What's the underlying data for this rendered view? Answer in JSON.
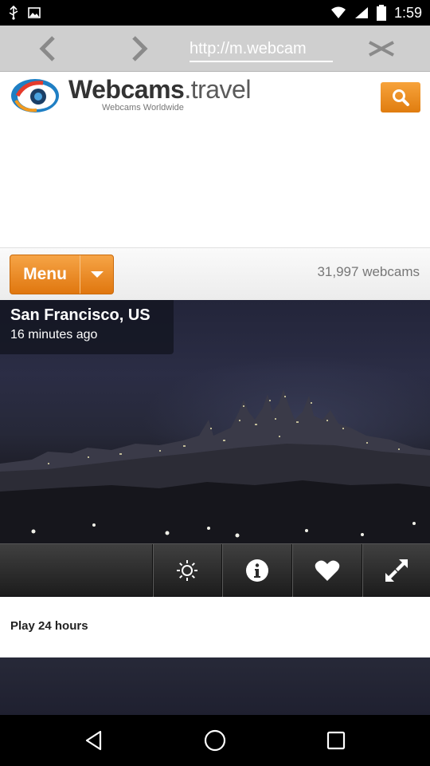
{
  "status_bar": {
    "time": "1:59",
    "icons": [
      "usb-icon",
      "photo-icon",
      "wifi-icon",
      "signal-icon",
      "battery-icon"
    ]
  },
  "browser": {
    "url": "http://m.webcam",
    "back_icon": "chevron-left-icon",
    "forward_icon": "chevron-right-icon",
    "close_icon": "close-icon"
  },
  "site": {
    "brand_bold": "Webcams",
    "brand_rest": ".travel",
    "tagline": "Webcams Worldwide",
    "accent_color": "#ef8c1e"
  },
  "menu": {
    "label": "Menu",
    "webcam_count": "31,997 webcams"
  },
  "webcam": {
    "location": "San Francisco, US",
    "updated": "16 minutes ago",
    "controls": [
      "brightness-icon",
      "info-icon",
      "heart-icon",
      "fullscreen-icon"
    ]
  },
  "play": {
    "label": "Play 24 hours"
  },
  "nav": {
    "icons": [
      "back-icon",
      "home-icon",
      "recents-icon"
    ]
  }
}
